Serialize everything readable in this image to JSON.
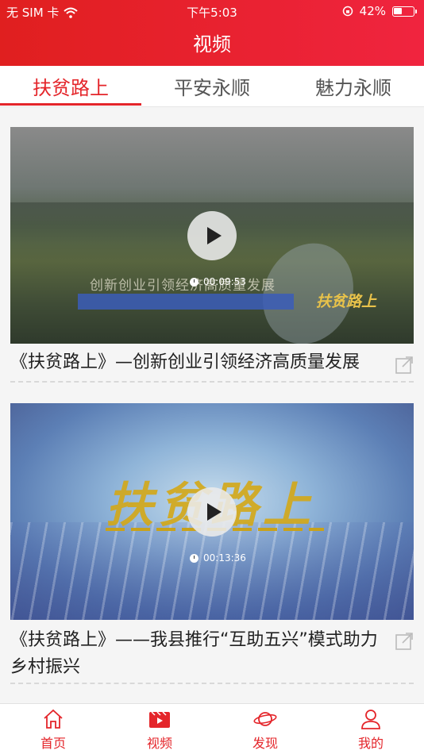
{
  "status_bar": {
    "carrier": "无 SIM 卡",
    "time": "下午5:03",
    "battery": "42%"
  },
  "header": {
    "title": "视频"
  },
  "tabs": [
    {
      "label": "扶贫路上",
      "active": true
    },
    {
      "label": "平安永顺",
      "active": false
    },
    {
      "label": "魅力永顺",
      "active": false
    }
  ],
  "videos": [
    {
      "title": "《扶贫路上》—创新创业引领经济高质量发展",
      "duration": "00:09:53",
      "overlay_text": "创新创业引领经济高质量发展",
      "logo_text": "扶贫路上"
    },
    {
      "title": "《扶贫路上》——我县推行“互助五兴”模式助力乡村振兴",
      "duration": "00:13:36",
      "overlay_text": "扶贫路上"
    }
  ],
  "bottom_nav": [
    {
      "label": "首页",
      "icon": "home-icon"
    },
    {
      "label": "视频",
      "icon": "video-icon",
      "active": true
    },
    {
      "label": "发现",
      "icon": "planet-icon"
    },
    {
      "label": "我的",
      "icon": "user-icon"
    }
  ],
  "colors": {
    "accent": "#e4252a",
    "header_gradient_start": "#e01f1f",
    "header_gradient_end": "#f0243f"
  }
}
